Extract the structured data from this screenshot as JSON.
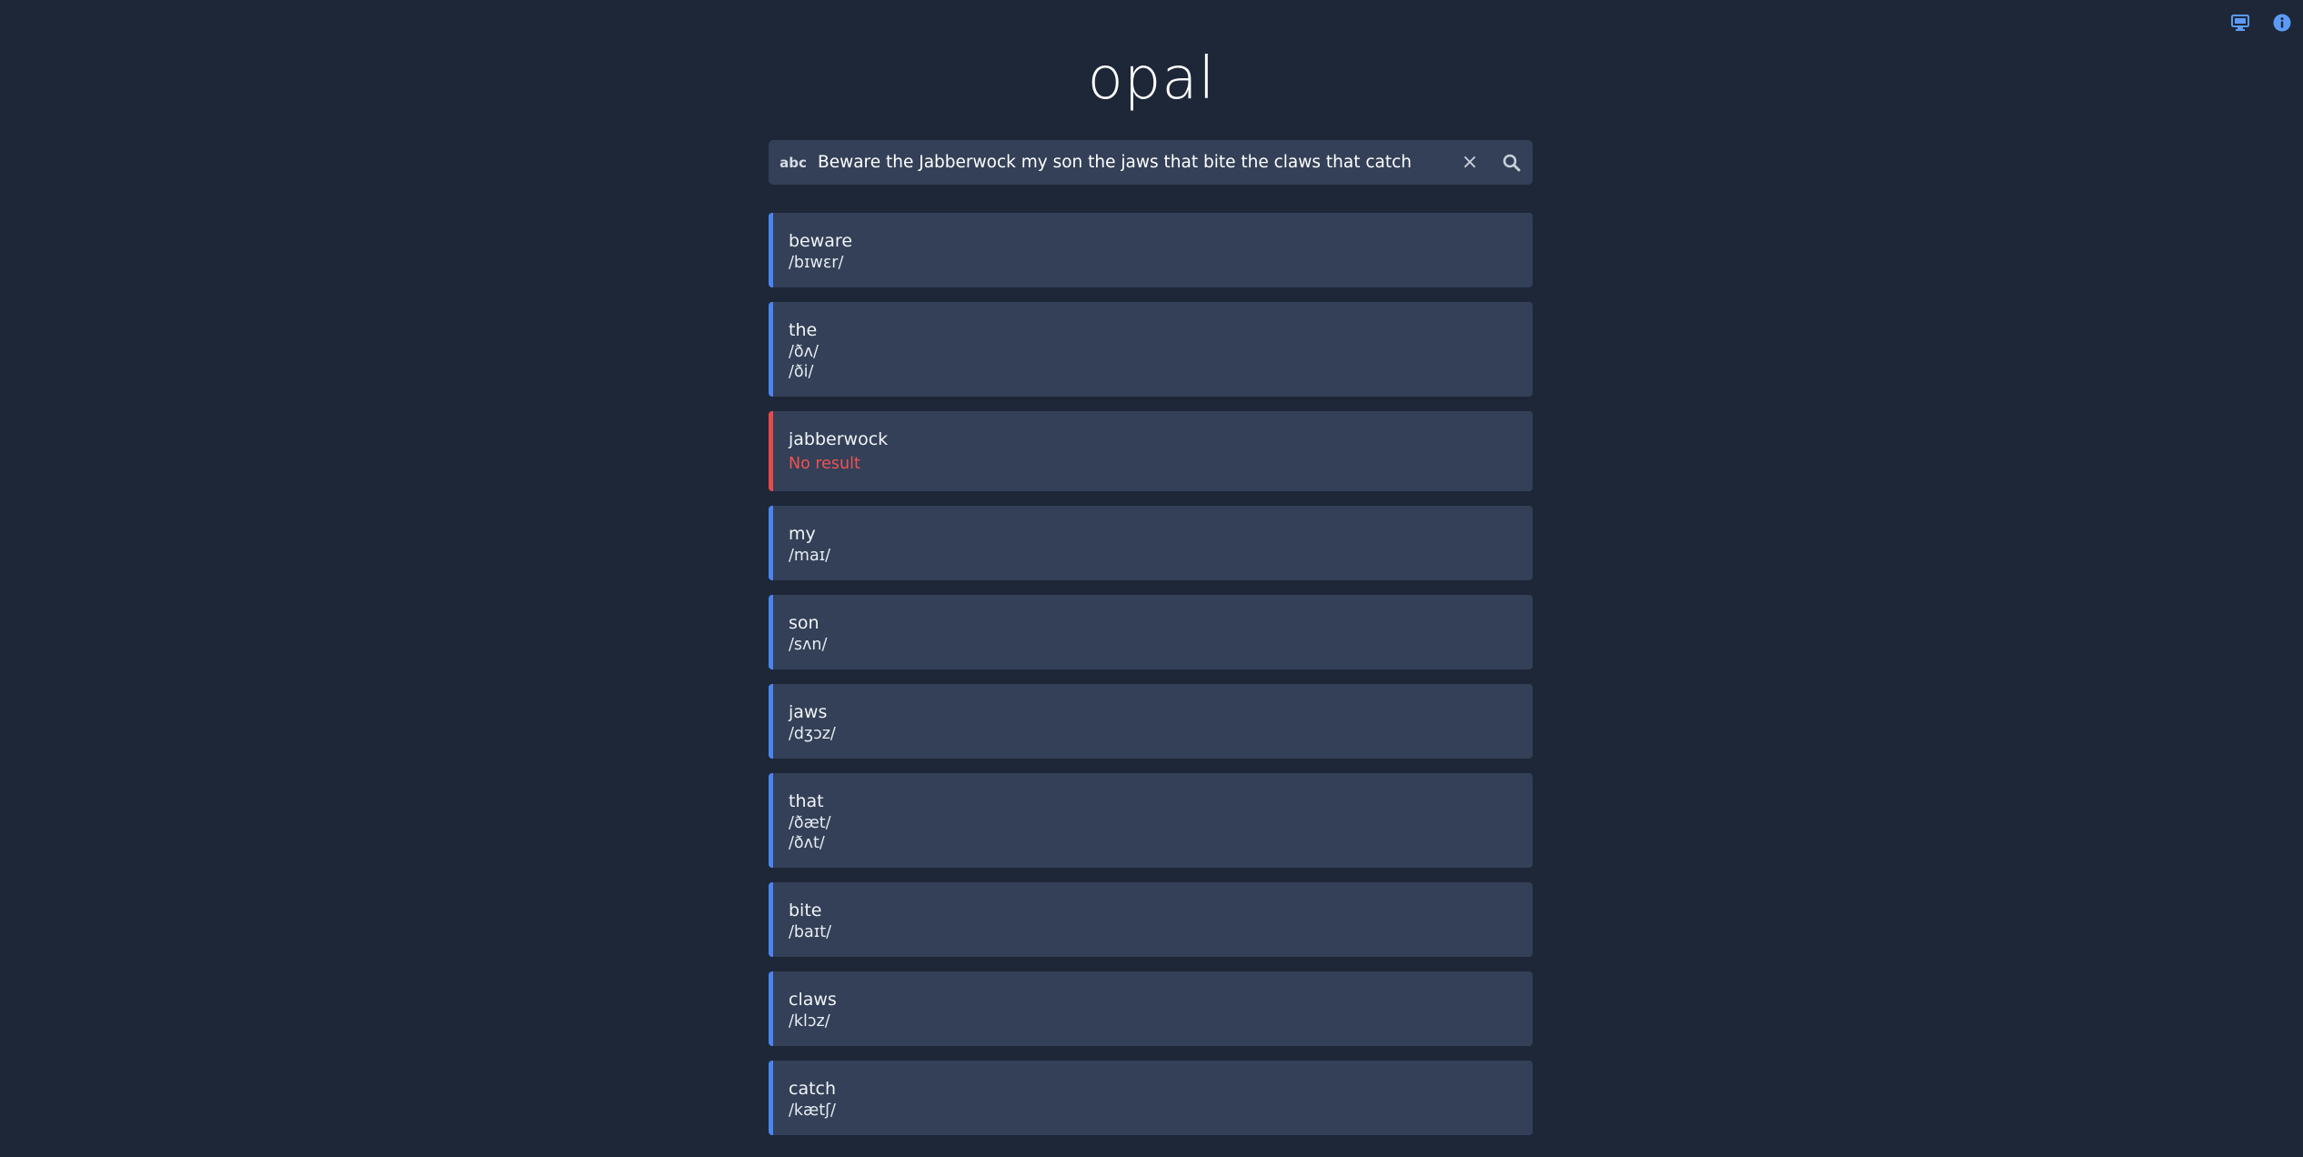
{
  "app": {
    "title": "opal",
    "top_icons": [
      "monitor-icon",
      "info-icon"
    ]
  },
  "search": {
    "mode_label": "abc",
    "value": "Beware the Jabberwock my son the jaws that bite the claws that catch",
    "clear_glyph": "×",
    "icons": [
      "search-icon"
    ]
  },
  "colors": {
    "background": "#1e2738",
    "card": "#334057",
    "accent_ok": "#4a84f0",
    "accent_error": "#e64a4a",
    "error_text": "#f05252"
  },
  "results": [
    {
      "word": "beware",
      "pronunciations": [
        "/bɪwɛr/"
      ],
      "status": "ok"
    },
    {
      "word": "the",
      "pronunciations": [
        "/ðʌ/",
        "/ði/"
      ],
      "status": "ok"
    },
    {
      "word": "jabberwock",
      "pronunciations": [],
      "status": "error",
      "message": "No result"
    },
    {
      "word": "my",
      "pronunciations": [
        "/maɪ/"
      ],
      "status": "ok"
    },
    {
      "word": "son",
      "pronunciations": [
        "/sʌn/"
      ],
      "status": "ok"
    },
    {
      "word": "jaws",
      "pronunciations": [
        "/dʒɔz/"
      ],
      "status": "ok"
    },
    {
      "word": "that",
      "pronunciations": [
        "/ðæt/",
        "/ðʌt/"
      ],
      "status": "ok"
    },
    {
      "word": "bite",
      "pronunciations": [
        "/baɪt/"
      ],
      "status": "ok"
    },
    {
      "word": "claws",
      "pronunciations": [
        "/klɔz/"
      ],
      "status": "ok"
    },
    {
      "word": "catch",
      "pronunciations": [
        "/kætʃ/"
      ],
      "status": "ok"
    }
  ]
}
